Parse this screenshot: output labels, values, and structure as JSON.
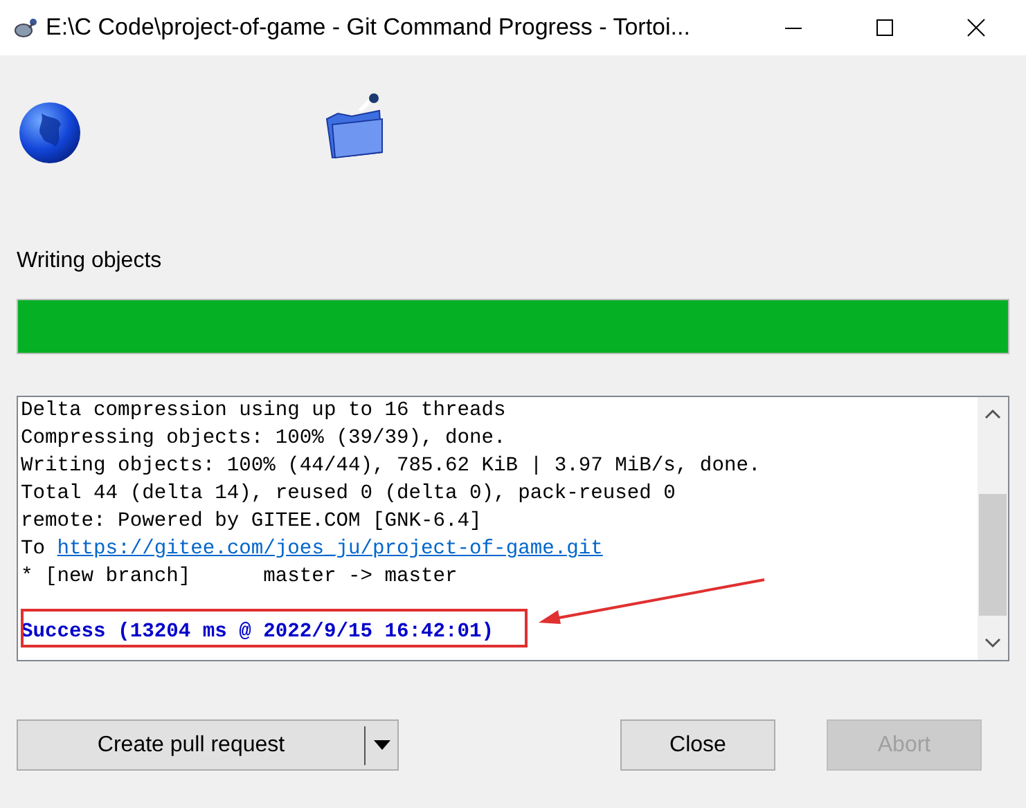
{
  "window": {
    "title": "E:\\C Code\\project-of-game - Git Command Progress - Tortoi..."
  },
  "status_label": "Writing objects",
  "progress": {
    "level": 1
  },
  "log": [
    {
      "kind": "text",
      "text": "Delta compression using up to 16 threads"
    },
    {
      "kind": "text",
      "text": "Compressing objects: 100% (39/39), done."
    },
    {
      "kind": "text",
      "text": "Writing objects: 100% (44/44), 785.62 KiB | 3.97 MiB/s, done."
    },
    {
      "kind": "text",
      "text": "Total 44 (delta 14), reused 0 (delta 0), pack-reused 0"
    },
    {
      "kind": "text",
      "text": "remote: Powered by GITEE.COM [GNK-6.4]"
    },
    {
      "kind": "link",
      "prefix": "To",
      "url": "https://gitee.com/joes_ju/project-of-game.git"
    },
    {
      "kind": "text",
      "text": "* [new branch]      master -> master"
    },
    {
      "kind": "blank"
    },
    {
      "kind": "success",
      "text": "Success (13204 ms @ 2022/9/15 16:42:01)"
    }
  ],
  "buttons": [
    {
      "label": "Create pull request",
      "kind": "split",
      "disabled": false
    },
    {
      "label": "Close",
      "kind": "plain",
      "disabled": false
    },
    {
      "label": "Abort",
      "kind": "plain",
      "disabled": true
    }
  ]
}
